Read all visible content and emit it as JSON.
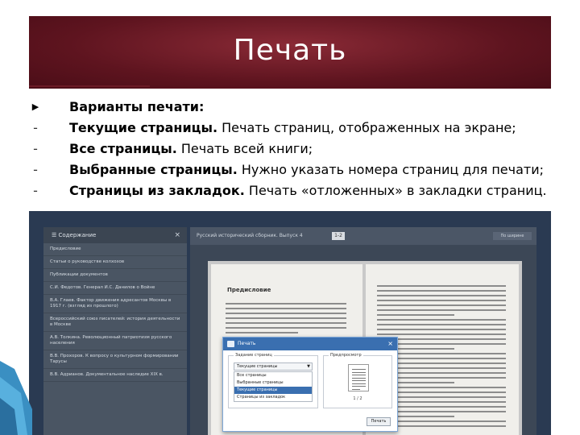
{
  "slide": {
    "title": "Печать",
    "bullets": [
      {
        "marker": "arrow",
        "strong": "Варианты печати:",
        "text": ""
      },
      {
        "marker": "dash",
        "strong": "Текущие страницы.",
        "text": " Печать страниц, отображенных на экране;"
      },
      {
        "marker": "dash",
        "strong": "Все страницы.",
        "text": " Печать всей книги;"
      },
      {
        "marker": "dash",
        "strong": "Выбранные страницы.",
        "text": " Нужно указать номера страниц для печати;"
      },
      {
        "marker": "dash",
        "strong": "Страницы из закладок.",
        "text": " Печать «отложенных» в закладки страниц."
      }
    ]
  },
  "screenshot": {
    "sidebar": {
      "header": "Содержание",
      "close": "×",
      "items": [
        "Предисловие",
        "Статьи о руководстве колхозов",
        "Публикации документов",
        "С.И. Федотов. Генерал И.С. Данилов о Войне",
        "В.А. Глаев. Фактор движения адресантов Москвы в 1917 г. (взгляд из прошлого)",
        "Всероссийский союз писателей: история деятельности в Москве",
        "А.В. Толкина. Революционный патриотизм русского населения",
        "В.В. Прохоров. К вопросу о культурном формировании Тарусы",
        "В.В. Адрианов. Документальное наследие XIX в."
      ]
    },
    "main": {
      "bar_title": "Русский исторический сборник. Выпуск 4",
      "page_num": "1-2",
      "zoom": "По ширине",
      "page_title": "Предисловие"
    },
    "dialog": {
      "title": "Печать",
      "close": "×",
      "group_label": "Задание страниц",
      "selected": "Текущие страницы",
      "options": [
        "Все страницы",
        "Выбранные страницы",
        "Текущие страницы",
        "Страницы из закладок"
      ],
      "selected_index": 2,
      "preview_label": "Предпросмотр",
      "count": "1 / 2",
      "print_button": "Печать"
    }
  },
  "colors": {
    "banner": "#5e141f",
    "dialog_header": "#3a6fb0",
    "sidebar": "#4a5563",
    "shot_bg": "#2a3a52"
  }
}
